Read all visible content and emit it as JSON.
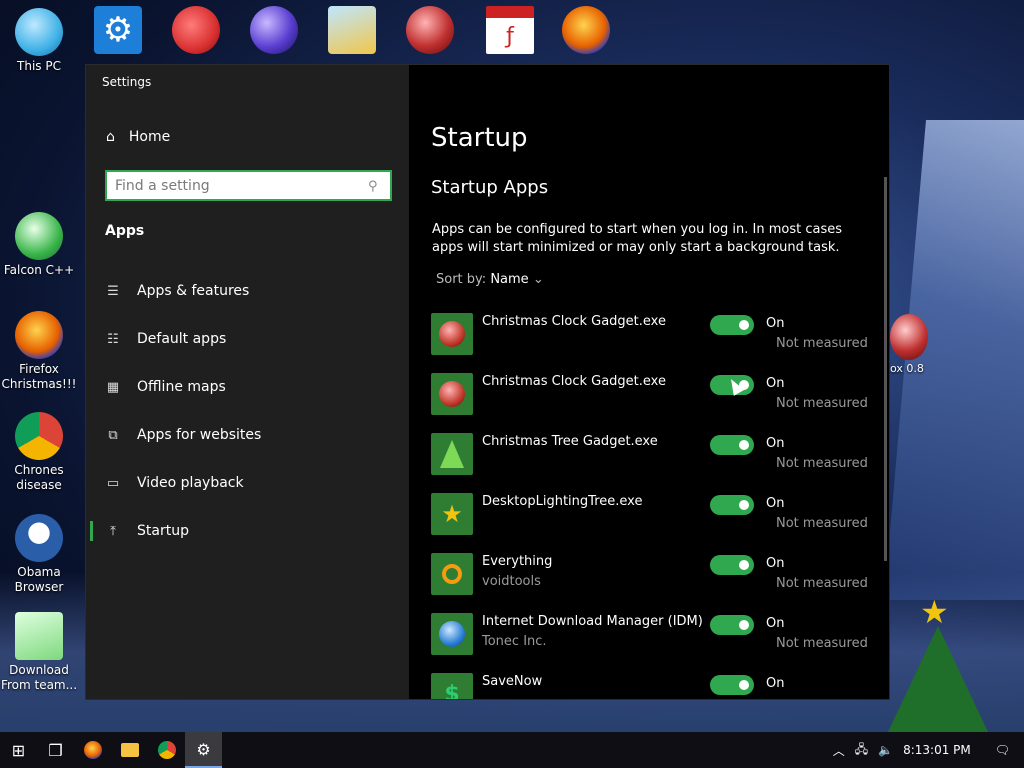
{
  "desktop": {
    "left_icons": [
      {
        "label": "This PC",
        "icon": "monitor-icon",
        "color": "#3fb1e6"
      },
      {
        "label": "Falcon C++",
        "icon": "recycle-icon",
        "color": "#39b54a"
      },
      {
        "label": "Firefox Christmas!!!",
        "icon": "firefox-icon",
        "color": "#e66000"
      },
      {
        "label": "Chrones disease",
        "icon": "chrome-icon",
        "color": "#4285f4"
      },
      {
        "label": "Obama Browser",
        "icon": "obama-logo-icon",
        "color": "#2a5ea8"
      },
      {
        "label": "Download From team...",
        "icon": "notepad-icon",
        "color": "#7ed87e"
      }
    ],
    "top_icons": [
      {
        "icon": "settings-gear-icon",
        "color": "#1e7fd8"
      },
      {
        "icon": "red-fuzzball-icon",
        "color": "#d93030"
      },
      {
        "icon": "ornament-ball-icon",
        "color": "#5a3fd1"
      },
      {
        "icon": "folder-app-icon",
        "color": "#f0c64a"
      },
      {
        "icon": "ornament-ball-icon",
        "color": "#c03030"
      },
      {
        "icon": "swf-file-icon",
        "color": "#cc2222"
      },
      {
        "icon": "firefox-icon",
        "color": "#e66000"
      }
    ],
    "right_label": "ox 0.8"
  },
  "window": {
    "title": "Settings",
    "controls": {
      "minimize": "—",
      "maximize": "▭",
      "close": "✕"
    }
  },
  "sidebar": {
    "home_label": "Home",
    "search_placeholder": "Find a setting",
    "section_title": "Apps",
    "items": [
      {
        "label": "Apps & features",
        "icon": "apps-list-icon"
      },
      {
        "label": "Default apps",
        "icon": "default-apps-icon"
      },
      {
        "label": "Offline maps",
        "icon": "map-icon"
      },
      {
        "label": "Apps for websites",
        "icon": "open-link-icon"
      },
      {
        "label": "Video playback",
        "icon": "video-icon"
      },
      {
        "label": "Startup",
        "icon": "startup-icon"
      }
    ]
  },
  "content": {
    "title": "Startup",
    "subtitle": "Startup Apps",
    "description": "Apps can be configured to start when you log in. In most cases apps will start minimized or may only start a background task.",
    "sort_label": "Sort by:",
    "sort_value": "Name",
    "apps": [
      {
        "name": "Christmas Clock Gadget.exe",
        "publisher": "",
        "state": "On",
        "impact": "Not measured",
        "icon_color": "#c0392b"
      },
      {
        "name": "Christmas Clock Gadget.exe",
        "publisher": "",
        "state": "On",
        "impact": "Not measured",
        "icon_color": "#c0392b"
      },
      {
        "name": "Christmas Tree Gadget.exe",
        "publisher": "",
        "state": "On",
        "impact": "Not measured",
        "icon_color": "#2e8b3a"
      },
      {
        "name": "DesktopLightingTree.exe",
        "publisher": "",
        "state": "On",
        "impact": "Not measured",
        "icon_color": "#f1c40f"
      },
      {
        "name": "Everything",
        "publisher": "voidtools",
        "state": "On",
        "impact": "Not measured",
        "icon_color": "#f39c12"
      },
      {
        "name": "Internet Download Manager (IDM)",
        "publisher": "Tonec Inc.",
        "state": "On",
        "impact": "Not measured",
        "icon_color": "#2a7fd4"
      },
      {
        "name": "SaveNow",
        "publisher": "",
        "state": "On",
        "impact": "",
        "icon_color": "#2ecc71"
      }
    ]
  },
  "taskbar": {
    "clock": "8:13:01 PM",
    "apps": [
      {
        "icon": "windows-start-icon"
      },
      {
        "icon": "task-view-icon"
      },
      {
        "icon": "firefox-icon"
      },
      {
        "icon": "file-explorer-icon"
      },
      {
        "icon": "chrome-icon"
      },
      {
        "icon": "settings-gear-icon"
      }
    ]
  },
  "accent_color": "#2fa84f"
}
